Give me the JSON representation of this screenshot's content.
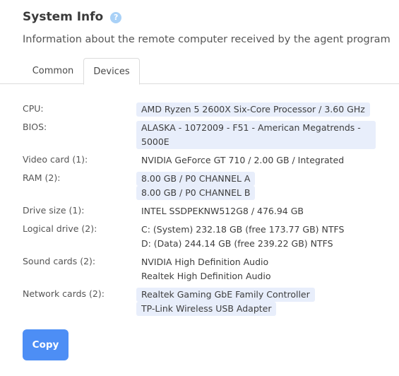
{
  "header": {
    "title": "System Info",
    "help_glyph": "?",
    "subtitle": "Information about the remote computer received by the agent program"
  },
  "tabs": [
    {
      "label": "Common",
      "active": false
    },
    {
      "label": "Devices",
      "active": true
    }
  ],
  "devices": {
    "cpu": {
      "label": "CPU:",
      "values": [
        "AMD Ryzen 5 2600X Six-Core Processor / 3.60 GHz"
      ]
    },
    "bios": {
      "label": "BIOS:",
      "values": [
        "ALASKA - 1072009 - F51 - American Megatrends -",
        "5000E"
      ]
    },
    "video": {
      "label": "Video card (1):",
      "values": [
        "NVIDIA GeForce GT 710 / 2.00 GB / Integrated"
      ]
    },
    "ram": {
      "label": "RAM (2):",
      "values": [
        "8.00 GB / P0 CHANNEL A",
        "8.00 GB / P0 CHANNEL B"
      ]
    },
    "drive": {
      "label": "Drive size (1):",
      "values": [
        "INTEL SSDPEKNW512G8 / 476.94 GB"
      ]
    },
    "logical": {
      "label": "Logical drive (2):",
      "values": [
        "C: (System) 232.18 GB (free 173.77 GB) NTFS",
        "D: (Data) 244.14 GB (free 239.22 GB) NTFS"
      ]
    },
    "sound": {
      "label": "Sound cards (2):",
      "values": [
        "NVIDIA High Definition Audio",
        "Realtek High Definition Audio"
      ]
    },
    "network": {
      "label": "Network cards (2):",
      "values": [
        "Realtek Gaming GbE Family Controller",
        "TP-Link Wireless USB Adapter"
      ]
    }
  },
  "actions": {
    "copy_label": "Copy"
  },
  "colors": {
    "accent": "#4d8ef5",
    "value_highlight": "#e8eefb",
    "help_icon": "#a9d1f7"
  },
  "icons": {
    "help": "question-circle-icon"
  }
}
